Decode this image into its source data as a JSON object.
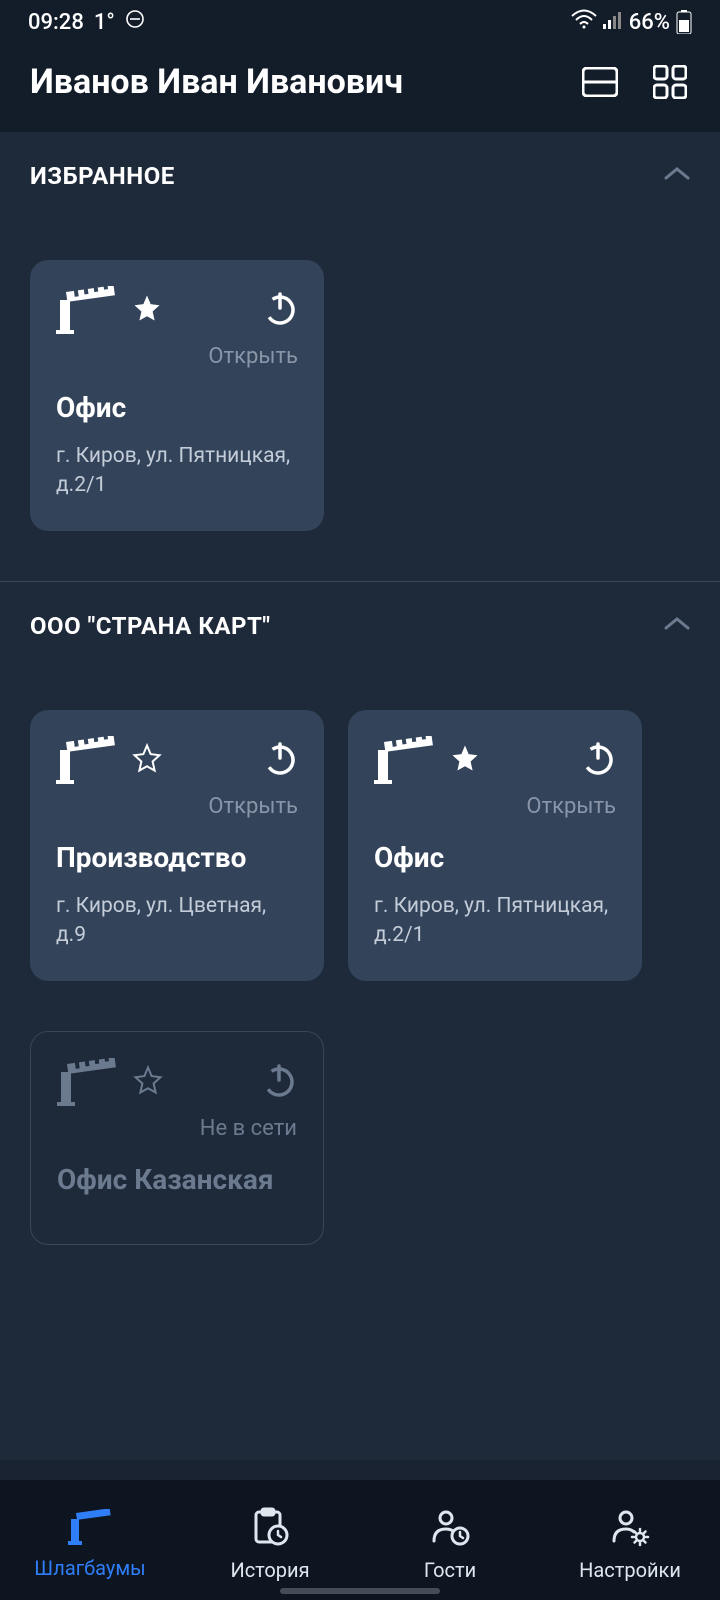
{
  "status": {
    "time": "09:28",
    "temp": "1°",
    "battery": "66%"
  },
  "header": {
    "user_name": "Иванов Иван Иванович"
  },
  "sections": [
    {
      "title": "ИЗБРАННОЕ",
      "cards": [
        {
          "name": "Офис",
          "address": "г. Киров, ул. Пятницкая, д.2/1",
          "status": "Открыть",
          "favorite": true,
          "offline": false
        }
      ]
    },
    {
      "title": "ООО \"СТРАНА КАРТ\"",
      "cards": [
        {
          "name": "Производство",
          "address": "г. Киров, ул. Цветная, д.9",
          "status": "Открыть",
          "favorite": false,
          "offline": false
        },
        {
          "name": "Офис",
          "address": "г. Киров, ул. Пятницкая, д.2/1",
          "status": "Открыть",
          "favorite": true,
          "offline": false
        },
        {
          "name": "Офис Казанская",
          "address": "",
          "status": "Не в сети",
          "favorite": false,
          "offline": true
        }
      ]
    }
  ],
  "nav": {
    "barriers": "Шлагбаумы",
    "history": "История",
    "guests": "Гости",
    "settings": "Настройки"
  }
}
